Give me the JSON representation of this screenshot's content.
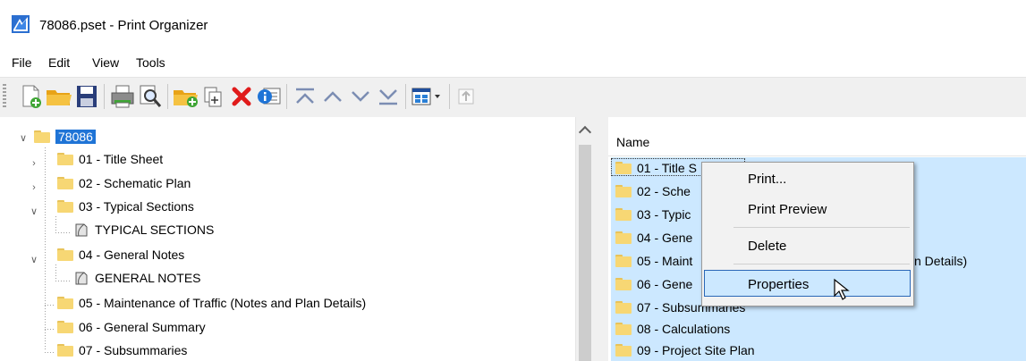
{
  "window": {
    "title": "78086.pset - Print Organizer",
    "app_icon": "print-organizer-icon"
  },
  "menu": [
    {
      "label": "File"
    },
    {
      "label": "Edit"
    },
    {
      "label": "View"
    },
    {
      "label": "Tools"
    }
  ],
  "toolbar": {
    "buttons": [
      {
        "name": "new-icon"
      },
      {
        "name": "open-icon"
      },
      {
        "name": "save-icon"
      },
      {
        "name": "print-icon"
      },
      {
        "name": "print-preview-icon"
      },
      {
        "name": "add-folder-icon"
      },
      {
        "name": "add-files-icon"
      },
      {
        "name": "delete-icon"
      },
      {
        "name": "properties-icon"
      },
      {
        "name": "move-top-icon"
      },
      {
        "name": "move-up-icon"
      },
      {
        "name": "move-down-icon"
      },
      {
        "name": "move-bottom-icon"
      },
      {
        "name": "view-mode-icon"
      },
      {
        "name": "go-up-icon"
      }
    ]
  },
  "tree": {
    "root": "78086",
    "items": [
      {
        "label": "01 - Title Sheet"
      },
      {
        "label": "02 - Schematic Plan"
      },
      {
        "label": "03 - Typical Sections"
      },
      {
        "label": "TYPICAL SECTIONS"
      },
      {
        "label": "04 - General Notes"
      },
      {
        "label": "GENERAL NOTES"
      },
      {
        "label": "05 - Maintenance of Traffic (Notes and Plan Details)"
      },
      {
        "label": "06 - General Summary"
      },
      {
        "label": "07 - Subsummaries"
      }
    ]
  },
  "list": {
    "column": "Name",
    "items": [
      {
        "label": "01 - Title S"
      },
      {
        "label": "02 - Sche"
      },
      {
        "label": "03 - Typic"
      },
      {
        "label": "04 - Gene"
      },
      {
        "label": "05 - Maint"
      },
      {
        "label": "06 - Gene"
      },
      {
        "label": "07 - Subsummaries"
      },
      {
        "label": "08 - Calculations"
      },
      {
        "label": "09 - Project Site Plan"
      }
    ],
    "peek_text": "n Details)"
  },
  "context_menu": {
    "items": [
      {
        "label": "Print..."
      },
      {
        "label": "Print Preview"
      },
      {
        "label": "Delete"
      },
      {
        "label": "Properties"
      }
    ],
    "highlighted": "Properties"
  },
  "colors": {
    "selection": "#cce8ff",
    "root_selection": "#1f74d6",
    "folder": "#f7d774"
  }
}
